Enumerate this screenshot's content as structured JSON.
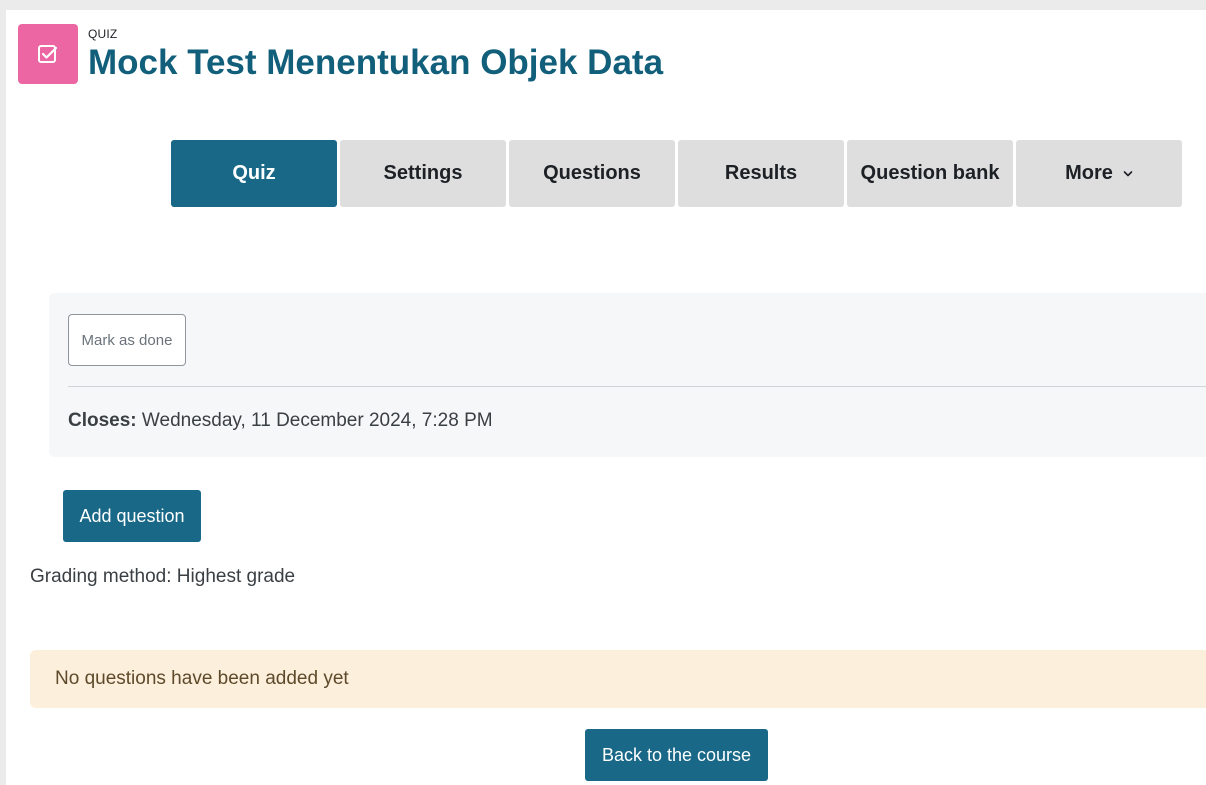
{
  "header": {
    "module_label": "QUIZ",
    "title": "Mock Test Menentukan Objek Data",
    "icon": "quiz-checkbox-icon",
    "icon_color": "#eb66a2"
  },
  "tabs": [
    {
      "label": "Quiz",
      "active": true
    },
    {
      "label": "Settings",
      "active": false
    },
    {
      "label": "Questions",
      "active": false
    },
    {
      "label": "Results",
      "active": false
    },
    {
      "label": "Question bank",
      "active": false
    },
    {
      "label": "More",
      "active": false
    }
  ],
  "activity": {
    "mark_done_label": "Mark as done",
    "closes_label": "Closes:",
    "closes_value": "Wednesday, 11 December 2024, 7:28 PM"
  },
  "actions": {
    "add_question_label": "Add question",
    "back_label": "Back to the course"
  },
  "grading": {
    "text": "Grading method: Highest grade"
  },
  "alert": {
    "text": "No questions have been added yet"
  },
  "colors": {
    "primary": "#196887",
    "title": "#115f7a",
    "alert_bg": "#fcefdc"
  }
}
